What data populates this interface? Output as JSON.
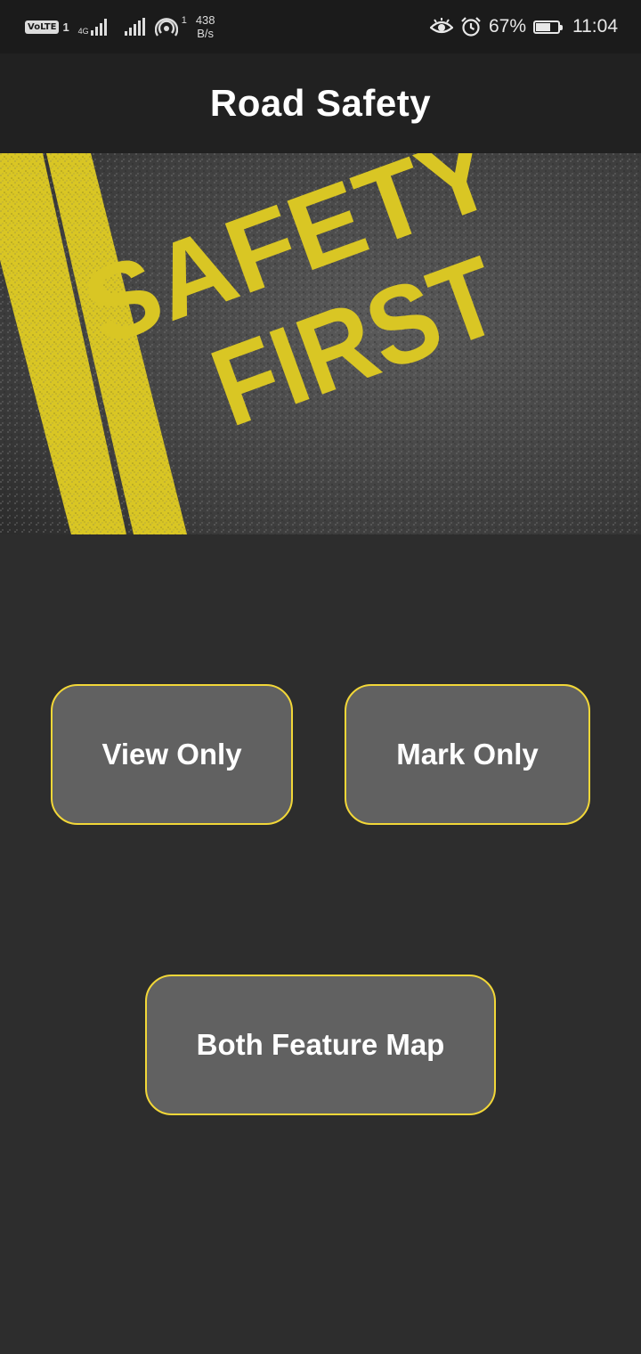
{
  "status_bar": {
    "volte": "VoLTE",
    "sim": "1",
    "network_type": "4G",
    "hotspot_count": "1",
    "speed_value": "438",
    "speed_unit": "B/s",
    "battery_percent": "67%",
    "battery_level": 0.67,
    "time": "11:04",
    "icons": [
      "volte-icon",
      "signal-icon",
      "signal-icon",
      "hotspot-icon",
      "eye-icon",
      "alarm-icon",
      "battery-icon"
    ]
  },
  "app_bar": {
    "title": "Road Safety"
  },
  "banner": {
    "line1": "SAFETY",
    "line2": "FIRST"
  },
  "buttons": {
    "view_only": "View Only",
    "mark_only": "Mark Only",
    "both_feature_map": "Both Feature Map"
  },
  "colors": {
    "accent": "#f2d738",
    "button_bg": "#616161",
    "background": "#2d2d2d",
    "app_bar": "#212121"
  }
}
